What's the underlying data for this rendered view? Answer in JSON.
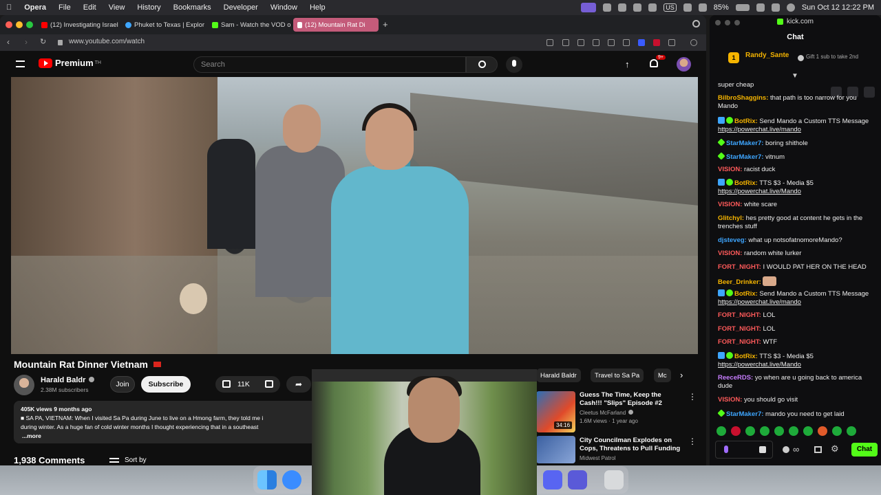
{
  "menubar": {
    "app": "Opera",
    "items": [
      "File",
      "Edit",
      "View",
      "History",
      "Bookmarks",
      "Developer",
      "Window",
      "Help"
    ],
    "battery": "85%",
    "input_source": "US",
    "clock": "Sun Oct 12  12:22 PM"
  },
  "browser": {
    "tabs": [
      {
        "label": "(12) Investigating Israeli",
        "favicon_color": "#ff0000"
      },
      {
        "label": "Phuket to Texas | Explor",
        "favicon_color": "#3ea6ff"
      },
      {
        "label": "Sam - Watch the VOD o",
        "favicon_color": "#53fc18"
      },
      {
        "label": "(12) Mountain Rat Di",
        "favicon_color": "#ff0000",
        "active": true
      }
    ],
    "url": "www.youtube.com/watch"
  },
  "youtube": {
    "logo": "Premium",
    "logo_sup": "TH",
    "search_placeholder": "Search",
    "notification_count": "9+",
    "video_title": "Mountain Rat Dinner Vietnam",
    "title_flag": "vietnam-flag-icon",
    "channel": "Harald Baldr",
    "subscribers": "2.38M subscribers",
    "join_label": "Join",
    "subscribe_label": "Subscribe",
    "likes": "11K",
    "description_meta": "405K views  9 months ago",
    "description_line1": "■ SA PA, VIETNAM: When I visited Sa Pa during June to live on a Hmong farm, they told me i",
    "description_line2": "during winter. As a huge fan of cold winter months I thought experiencing that in a southeast",
    "description_more": "...more",
    "comments_count": "1,938 Comments",
    "sort_by": "Sort by",
    "chips": [
      "Harald Baldr",
      "Travel to Sa Pa",
      "Mc"
    ],
    "recommended": [
      {
        "title": "Guess The Time, Keep the Cash!!! \"Slips\" Episode #2",
        "channel": "Cleetus McFarland",
        "meta": "1.6M views · 1 year ago",
        "duration": "34:16"
      },
      {
        "title": "City Councilman Explodes on Cops, Threatens to Pull Funding",
        "channel": "Midwest Patrol",
        "meta": ""
      }
    ]
  },
  "chat": {
    "site": "kick.com",
    "title": "Chat",
    "gifter": {
      "rank": "1",
      "name": "Randy_Sante"
    },
    "gift_text": "Gift 1 sub to take 2nd",
    "messages": [
      {
        "user": "",
        "text": "super cheap",
        "color": "#eeeeee"
      },
      {
        "user": "BilbroShaggins:",
        "text": "that path is too narrow for you Mando",
        "color": "#f5b400"
      },
      {
        "user": "BotRix:",
        "text": "Send Mando a Custom TTS Message",
        "link": "https://powerchat.live/mando",
        "color": "#f5b400"
      },
      {
        "user": "StarMaker7:",
        "text": "boring shithole",
        "color": "#3ea6ff"
      },
      {
        "user": "StarMaker7:",
        "text": "vitnum",
        "color": "#3ea6ff"
      },
      {
        "user": "VISION:",
        "text": "racist duck",
        "color": "#ff5a5a"
      },
      {
        "user": "BotRix:",
        "text": "TTS $3 - Media $5",
        "link": "https://powerchat.live/Mando",
        "color": "#f5b400"
      },
      {
        "user": "VISION:",
        "text": "white scare",
        "color": "#ff5a5a"
      },
      {
        "user": "Glitchyl:",
        "text": "hes pretty good at content he gets in the trenches stuff",
        "color": "#f5b400"
      },
      {
        "user": "djsteveg:",
        "text": "what up notsofatnomoreMando?",
        "color": "#3ea6ff"
      },
      {
        "user": "VISION:",
        "text": "random white lurker",
        "color": "#ff5a5a"
      },
      {
        "user": "FORT_NIGHT:",
        "text": "I WOULD PAT HER ON THE HEAD",
        "color": "#ff5a5a"
      },
      {
        "user": "Beer_Drinker:",
        "text": "",
        "color": "#f5b400"
      },
      {
        "user": "BotRix:",
        "text": "Send Mando a Custom TTS Message",
        "link": "https://powerchat.live/mando",
        "color": "#f5b400"
      },
      {
        "user": "FORT_NIGHT:",
        "text": "LOL",
        "color": "#ff5a5a"
      },
      {
        "user": "FORT_NIGHT:",
        "text": "LOL",
        "color": "#ff5a5a"
      },
      {
        "user": "FORT_NIGHT:",
        "text": "WTF",
        "color": "#ff5a5a"
      },
      {
        "user": "BotRix:",
        "text": "TTS $3 - Media $5",
        "link": "https://powerchat.live/Mando",
        "color": "#f5b400"
      },
      {
        "user": "ReeceRDS:",
        "text": "yo when are u going back to america dude",
        "color": "#c77dff"
      },
      {
        "user": "VISION:",
        "text": "you should go visit",
        "color": "#ff5a5a"
      },
      {
        "user": "StarMaker7:",
        "text": "mando you need to get laid",
        "color": "#3ea6ff"
      }
    ],
    "send_label": "Chat"
  }
}
